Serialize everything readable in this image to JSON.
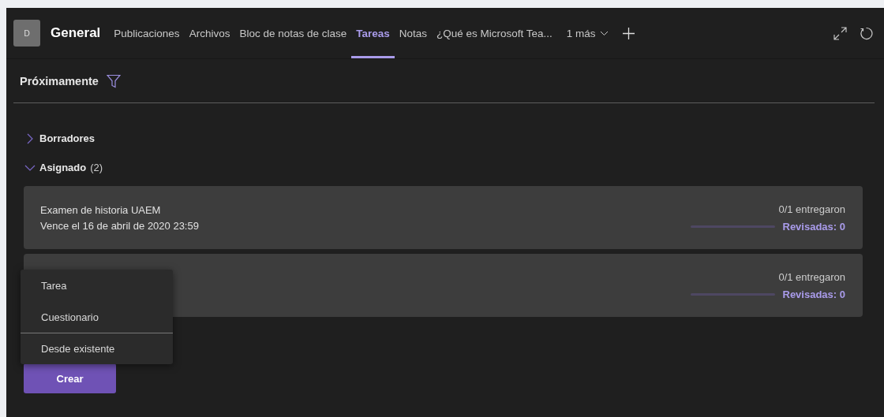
{
  "header": {
    "avatar": "D",
    "title": "General",
    "tabs": [
      {
        "label": "Publicaciones",
        "selected": false
      },
      {
        "label": "Archivos",
        "selected": false
      },
      {
        "label": "Bloc de notas de clase",
        "selected": false
      },
      {
        "label": "Tareas",
        "selected": true
      },
      {
        "label": "Notas",
        "selected": false
      },
      {
        "label": "¿Qué es Microsoft Tea...",
        "selected": false
      }
    ],
    "more": "1 más"
  },
  "view": {
    "title": "Próximamente"
  },
  "groups": [
    {
      "label": "Borradores",
      "expanded": false
    },
    {
      "label": "Asignado",
      "count": "(2)",
      "expanded": true
    }
  ],
  "assignments": [
    {
      "title": "Examen de historia UAEM",
      "due": "Vence el 16 de abril de 2020 23:59",
      "turned_in": "0/1 entregaron",
      "level": 0,
      "reviewed": "Revisadas: 0"
    },
    {
      "turned_in": "0/1 entregaron",
      "level": 0,
      "reviewed": "Revisadas: 0"
    }
  ],
  "menu": {
    "items": [
      {
        "label": "Tarea",
        "separator": false
      },
      {
        "label": "Cuestionario",
        "separator": false
      },
      {
        "label": "Desde existente",
        "separator": true
      }
    ]
  },
  "create_button": "Crear"
}
